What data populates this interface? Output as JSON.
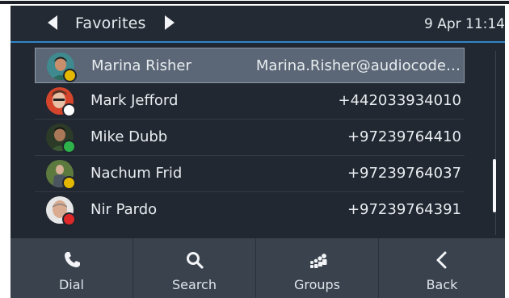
{
  "header": {
    "title": "Favorites",
    "clock": "9 Apr 11:14"
  },
  "contacts": [
    {
      "name": "Marina Risher",
      "detail": "Marina.Risher@audiocode…",
      "status": "away",
      "selected": true
    },
    {
      "name": "Mark Jefford",
      "detail": "+442033934010",
      "status": "offline",
      "selected": false
    },
    {
      "name": "Mike Dubb",
      "detail": "+97239764410",
      "status": "available",
      "selected": false
    },
    {
      "name": "Nachum Frid",
      "detail": "+97239764037",
      "status": "away",
      "selected": false
    },
    {
      "name": "Nir Pardo",
      "detail": "+97239764391",
      "status": "busy",
      "selected": false
    }
  ],
  "status_colors": {
    "away": "#e5b800",
    "offline": "#ffffff",
    "available": "#2db34a",
    "busy": "#e02828"
  },
  "softkeys": [
    {
      "label": "Dial",
      "icon": "phone-icon"
    },
    {
      "label": "Search",
      "icon": "search-icon"
    },
    {
      "label": "Groups",
      "icon": "groups-icon"
    },
    {
      "label": "Back",
      "icon": "back-chevron-icon"
    }
  ]
}
